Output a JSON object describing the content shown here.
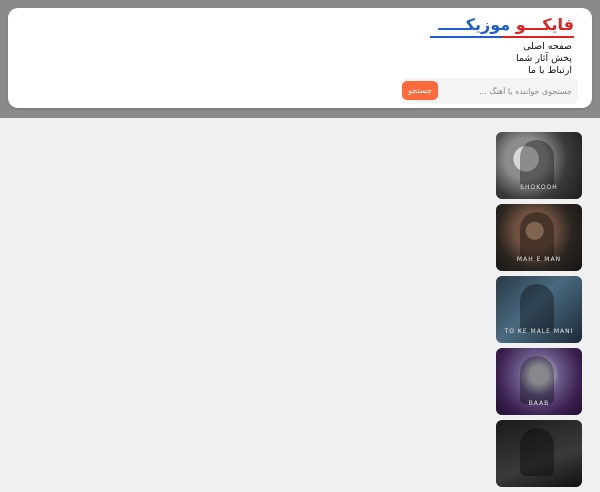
{
  "logo": {
    "part1": "فایکـــ",
    "part2": "و",
    "part3": " موزیکـــــ"
  },
  "nav": {
    "items": [
      {
        "label": "صفحه اصلی"
      },
      {
        "label": "پخش آثار شما"
      },
      {
        "label": "ارتباط با ما"
      }
    ]
  },
  "search": {
    "placeholder": "جستجوی خواننده یا آهنگ ...",
    "button_label": "جستجو"
  },
  "thumbnails": [
    {
      "caption": "SHOKOOH"
    },
    {
      "caption": "MAH E MAN"
    },
    {
      "caption": "TO KE MALE MANI"
    },
    {
      "caption": "BAAB"
    },
    {
      "caption": ""
    }
  ],
  "colors": {
    "logo_red": "#e02020",
    "logo_blue": "#1e5fd0",
    "search_button": "#ff6a3d",
    "top_band": "#8a8a8a"
  }
}
